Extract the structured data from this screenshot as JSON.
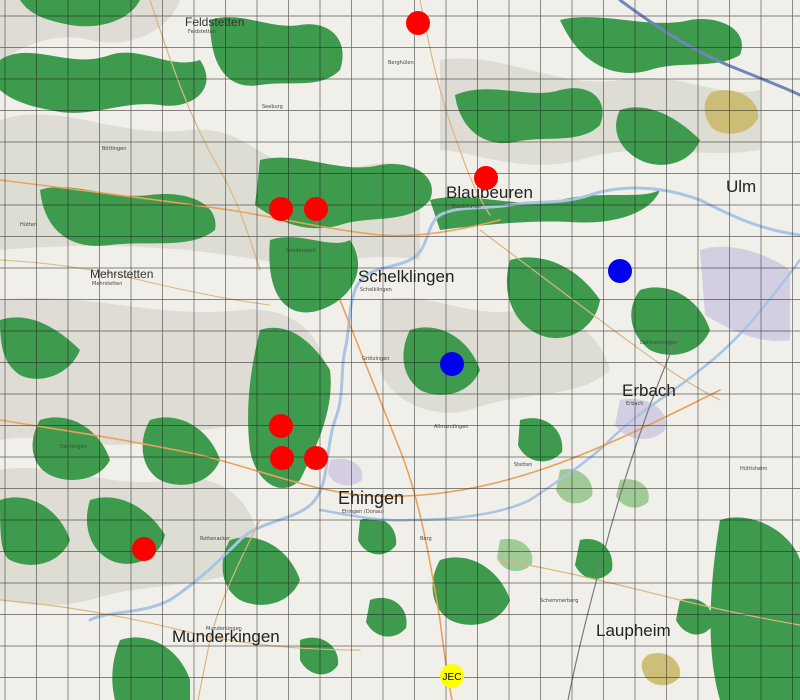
{
  "map": {
    "colors": {
      "background": "#f1efe9",
      "relief": "#dcdad2",
      "forest": "#3e9a4c",
      "forest_light": "#86c07c",
      "water": "#a9c5e4",
      "motorway": "#6f86b8",
      "road_primary": "#e8a25a",
      "road_secondary": "#d9b880",
      "rail": "#7a7a7a",
      "grid": "#222222",
      "industrial": "#cfc8e2",
      "airfield": "#c9b96a",
      "marker_red": "#ff0000",
      "marker_blue": "#0000ee",
      "marker_yellow": "#ffff00"
    },
    "places_large": [
      {
        "name": "Feldstetten",
        "kind": "small"
      },
      {
        "name": "Blaubeuren",
        "kind": "big"
      },
      {
        "name": "Ulm",
        "kind": "big"
      },
      {
        "name": "Mehrstetten",
        "kind": "small"
      },
      {
        "name": "Schelklingen",
        "kind": "big"
      },
      {
        "name": "Erbach",
        "kind": "big"
      },
      {
        "name": "Ehingen",
        "kind": "big"
      },
      {
        "name": "Munderkingen",
        "kind": "big"
      },
      {
        "name": "Laupheim",
        "kind": "big"
      }
    ],
    "places_sub": [
      {
        "name": "Feldstetten"
      },
      {
        "name": "Blaubeuren"
      },
      {
        "name": "Mehrstetten"
      },
      {
        "name": "Schelklingen"
      },
      {
        "name": "Erbach"
      },
      {
        "name": "Ehingen (Donau)"
      },
      {
        "name": "Munderkingen"
      }
    ],
    "markers": [
      {
        "color": "red"
      },
      {
        "color": "red"
      },
      {
        "color": "red"
      },
      {
        "color": "red"
      },
      {
        "color": "red"
      },
      {
        "color": "red"
      },
      {
        "color": "red"
      },
      {
        "color": "red"
      },
      {
        "color": "blue"
      },
      {
        "color": "blue"
      },
      {
        "color": "yellow",
        "label": "JEC"
      }
    ]
  }
}
